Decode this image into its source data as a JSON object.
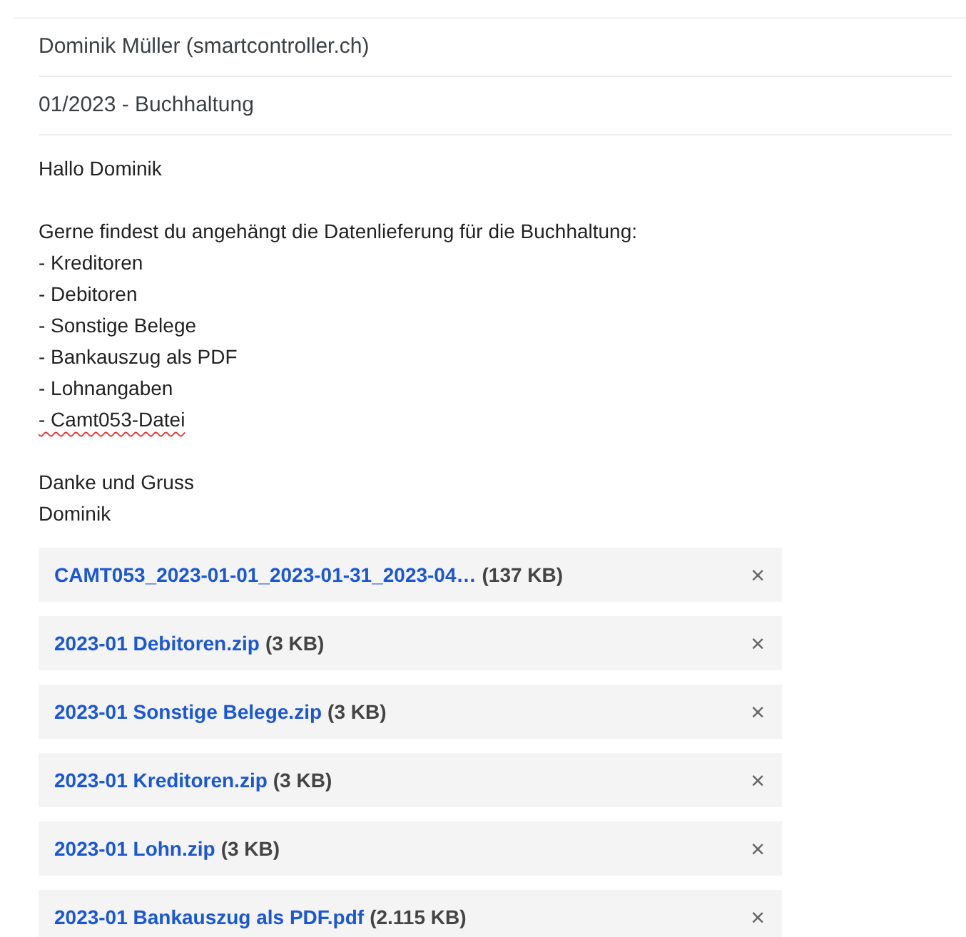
{
  "recipient": "Dominik Müller (smartcontroller.ch)",
  "subject": "01/2023 - Buchhaltung",
  "body": {
    "paragraphs": [
      [
        {
          "text": "Hallo Dominik",
          "spelling_error": false
        }
      ],
      [
        {
          "text": "Gerne findest du angehängt die Datenlieferung für die Buchhaltung:",
          "spelling_error": false
        },
        {
          "text": "- Kreditoren",
          "spelling_error": false
        },
        {
          "text": "- Debitoren",
          "spelling_error": false
        },
        {
          "text": "- Sonstige Belege",
          "spelling_error": false
        },
        {
          "text": "- Bankauszug als PDF",
          "spelling_error": false
        },
        {
          "text": "- Lohnangaben",
          "spelling_error": false
        },
        {
          "text": "- Camt053-Datei",
          "spelling_error": true
        }
      ],
      [
        {
          "text": "Danke und Gruss",
          "spelling_error": false
        },
        {
          "text": "Dominik",
          "spelling_error": false
        }
      ]
    ]
  },
  "attachments": [
    {
      "name": "CAMT053_2023-01-01_2023-01-31_2023-04…",
      "size": "(137 KB)",
      "remove": "×"
    },
    {
      "name": "2023-01 Debitoren.zip",
      "size": "(3 KB)",
      "remove": "×"
    },
    {
      "name": "2023-01 Sonstige Belege.zip",
      "size": "(3 KB)",
      "remove": "×"
    },
    {
      "name": "2023-01 Kreditoren.zip",
      "size": "(3 KB)",
      "remove": "×"
    },
    {
      "name": "2023-01 Lohn.zip",
      "size": "(3 KB)",
      "remove": "×"
    },
    {
      "name": "2023-01 Bankauszug als PDF.pdf",
      "size": "(2.115 KB)",
      "remove": "×"
    }
  ]
}
